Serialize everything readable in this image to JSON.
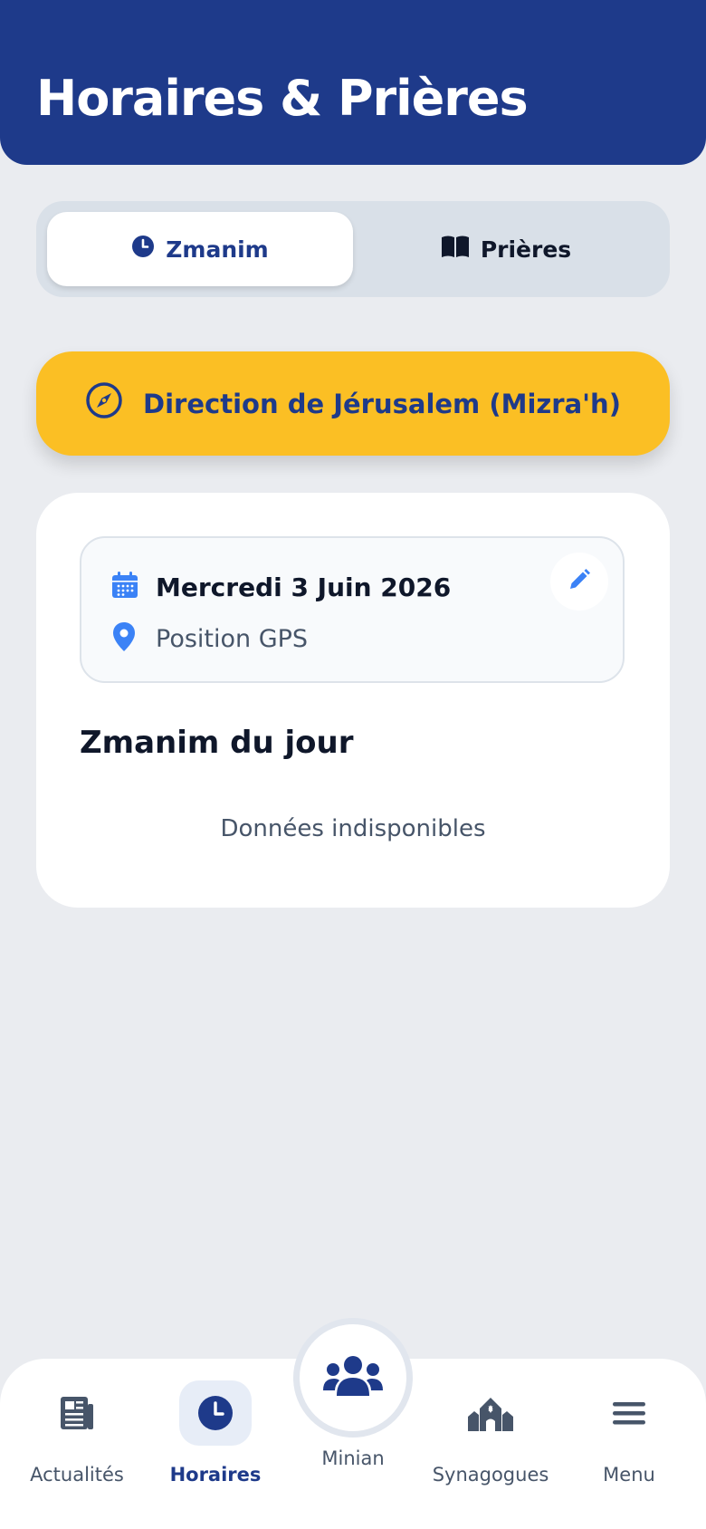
{
  "header": {
    "title": "Horaires & Prières"
  },
  "tabs": [
    {
      "label": "Zmanim",
      "icon": "clock-icon",
      "active": true
    },
    {
      "label": "Prières",
      "icon": "book-icon",
      "active": false
    }
  ],
  "mizrah_button": {
    "label": "Direction de Jérusalem (Mizra'h)",
    "icon": "compass-icon"
  },
  "card": {
    "date": "Mercredi 3 Juin 2026",
    "location": "Position GPS",
    "section_title": "Zmanim du jour",
    "empty_message": "Données indisponibles"
  },
  "nav": {
    "items": [
      {
        "label": "Actualités",
        "icon": "newspaper-icon",
        "active": false
      },
      {
        "label": "Horaires",
        "icon": "clock-icon",
        "active": true
      },
      {
        "label": "Minian",
        "icon": "users-icon",
        "active": false
      },
      {
        "label": "Synagogues",
        "icon": "synagogue-icon",
        "active": false
      },
      {
        "label": "Menu",
        "icon": "menu-icon",
        "active": false
      }
    ]
  },
  "colors": {
    "primary": "#1e3a8a",
    "accent": "#fbbf24",
    "background": "#eaecf0",
    "icon_blue": "#3b82f6",
    "text_dark": "#0f172a",
    "text_muted": "#475569"
  }
}
